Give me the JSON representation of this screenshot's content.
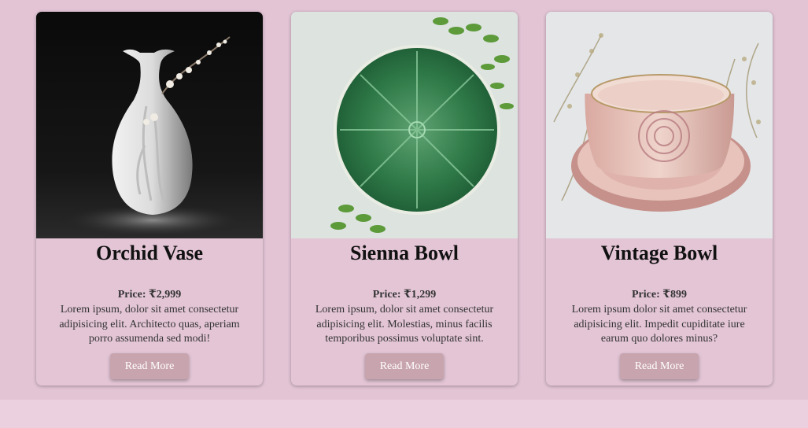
{
  "products": [
    {
      "title": "Orchid Vase",
      "price": "Price: ₹2,999",
      "description": "Lorem ipsum, dolor sit amet consectetur adipisicing elit. Architecto quas, aperiam porro assumenda sed modi!",
      "button_label": "Read More",
      "image": "white-orchid-vase-photo"
    },
    {
      "title": "Sienna Bowl",
      "price": "Price: ₹1,299",
      "description": "Lorem ipsum, dolor sit amet consectetur adipisicing elit. Molestias, minus facilis temporibus possimus voluptate sint.",
      "button_label": "Read More",
      "image": "green-cabbage-bowl-photo"
    },
    {
      "title": "Vintage Bowl",
      "price": "Price: ₹899",
      "description": "Lorem ipsum dolor sit amet consectetur adipisicing elit. Impedit cupiditate iure earum quo dolores minus?",
      "button_label": "Read More",
      "image": "pink-rose-cup-photo"
    }
  ],
  "colors": {
    "page_background": "#e2c4d5",
    "card_background": "#e3c5d5",
    "button_background": "#c8a4ae",
    "footer_band": "#ebd0df"
  }
}
